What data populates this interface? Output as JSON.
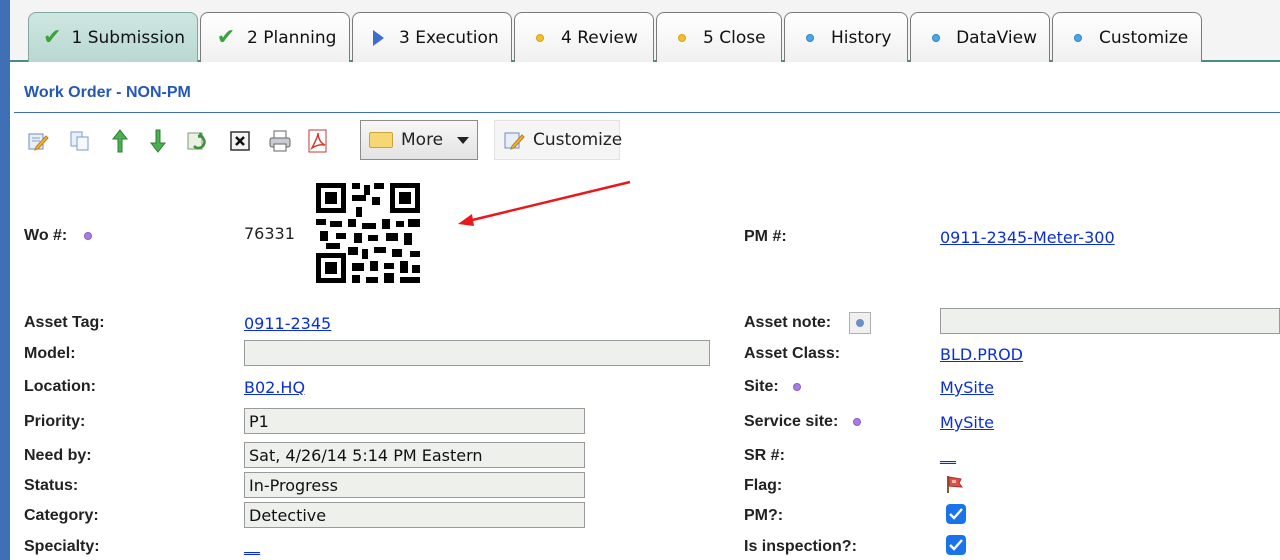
{
  "tabs": [
    {
      "label": "1 Submission",
      "icon": "check-icon",
      "active": true
    },
    {
      "label": "2 Planning",
      "icon": "check-icon"
    },
    {
      "label": "3 Execution",
      "icon": "play-triangle-icon"
    },
    {
      "label": "4 Review",
      "icon": "yellow-dot-icon"
    },
    {
      "label": "5 Close",
      "icon": "yellow-dot-icon"
    },
    {
      "label": "History",
      "icon": "blue-dot-icon"
    },
    {
      "label": "DataView",
      "icon": "blue-dot-icon"
    },
    {
      "label": "Customize",
      "icon": "blue-dot-icon"
    }
  ],
  "page_title": "Work Order - NON-PM",
  "toolbar": {
    "icons": [
      "edit-icon",
      "copy-icon",
      "arrow-up-icon",
      "arrow-down-icon",
      "refresh-icon",
      "delete-icon",
      "print-icon",
      "pdf-icon"
    ],
    "more_label": "More",
    "customize_label": "Customize"
  },
  "fields": {
    "wo_label": "Wo #:",
    "wo_value": "76331",
    "pm_label": "PM #:",
    "pm_value": "0911-2345-Meter-300",
    "asset_tag_label": "Asset Tag:",
    "asset_tag_value": "0911-2345",
    "asset_note_label": "Asset note:",
    "asset_note_value": "",
    "model_label": "Model:",
    "model_value": "",
    "asset_class_label": "Asset Class:",
    "asset_class_value": "BLD.PROD",
    "location_label": "Location:",
    "location_value": "B02.HQ",
    "site_label": "Site:",
    "site_value": "MySite",
    "priority_label": "Priority:",
    "priority_value": "P1",
    "service_site_label": "Service site:",
    "service_site_value": "MySite",
    "need_by_label": "Need by:",
    "need_by_value": "Sat, 4/26/14 5:14 PM Eastern",
    "sr_label": "SR #:",
    "sr_value": "__",
    "status_label": "Status:",
    "status_value": "In-Progress",
    "flag_label": "Flag:",
    "category_label": "Category:",
    "category_value": "Detective",
    "pm_q_label": "PM?:",
    "pm_q_checked": true,
    "specialty_label": "Specialty:",
    "specialty_value": "__",
    "inspection_label": "Is inspection?:",
    "inspection_checked": true
  },
  "colors": {
    "title_blue": "#2457b8",
    "link_blue": "#0a2fd6",
    "active_tab": "#b8d8d1",
    "annotation_arrow": "#e8191d"
  }
}
